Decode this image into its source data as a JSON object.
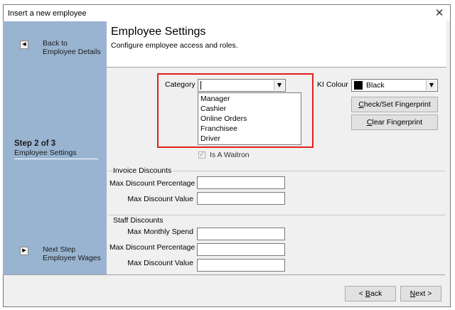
{
  "window": {
    "title": "Insert a new employee",
    "close_glyph": "✕"
  },
  "sidebar": {
    "back": {
      "icon": "left-arrow-icon",
      "glyph": "◀",
      "line1": "Back to",
      "line2": "Employee Details"
    },
    "step": {
      "title": "Step 2 of 3",
      "subtitle": "Employee Settings"
    },
    "next": {
      "icon": "right-arrow-icon",
      "glyph": "▶",
      "line1": "Next Step",
      "line2": "Employee Wages"
    }
  },
  "header": {
    "title": "Employee Settings",
    "subtitle": "Configure employee access and roles."
  },
  "category": {
    "label": "Category",
    "value": "",
    "options": [
      "Manager",
      "Cashier",
      "Online Orders",
      "Franchisee",
      "Driver"
    ],
    "arrow_glyph": "▼"
  },
  "ki_colour": {
    "label": "KI Colour",
    "value": "Black",
    "swatch_color": "#000000"
  },
  "buttons": {
    "check_fingerprint": {
      "underline": "C",
      "rest": "heck/Set Fingerprint"
    },
    "clear_fingerprint": {
      "underline": "C",
      "rest": "lear Fingerprint"
    },
    "back": {
      "pre": "< ",
      "underline": "B",
      "rest": "ack"
    },
    "next": {
      "underline": "N",
      "rest": "ext >"
    }
  },
  "waitron": {
    "label": "Is A Waitron",
    "checked": true,
    "check_glyph": "✓"
  },
  "invoice_discounts": {
    "title": "Invoice Discounts",
    "fields": [
      {
        "label": "Max Discount Percentage",
        "value": ""
      },
      {
        "label": "Max Discount Value",
        "value": ""
      }
    ]
  },
  "staff_discounts": {
    "title": "Staff Discounts",
    "fields": [
      {
        "label": "Max Monthly Spend",
        "value": ""
      },
      {
        "label": "Max Discount Percentage",
        "value": ""
      },
      {
        "label": "Max Discount Value",
        "value": ""
      }
    ]
  },
  "colors": {
    "sidebar": "#99b4d1",
    "highlight": "#e0201a"
  }
}
